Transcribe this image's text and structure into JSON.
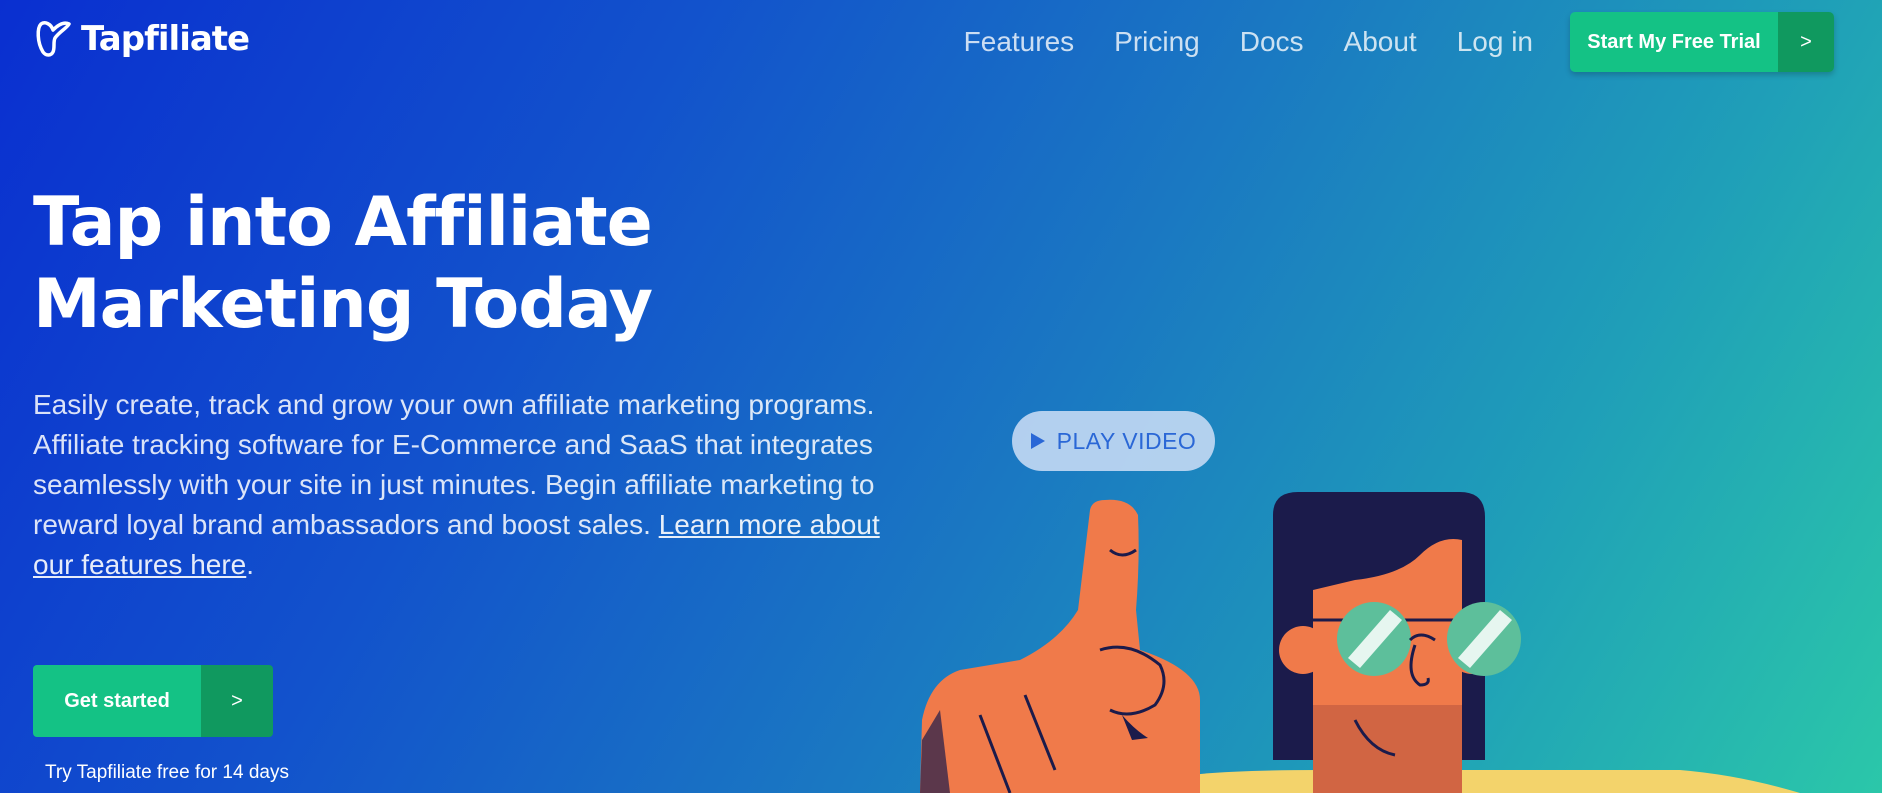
{
  "brand": {
    "name": "Tapfiliate"
  },
  "nav": {
    "items": [
      {
        "label": "Features"
      },
      {
        "label": "Pricing"
      },
      {
        "label": "Docs"
      },
      {
        "label": "About"
      },
      {
        "label": "Log in"
      }
    ],
    "cta_label": "Start My Free Trial",
    "cta_arrow": ">"
  },
  "hero": {
    "title_line1": "Tap into Affiliate",
    "title_line2": "Marketing Today",
    "description": "Easily create, track and grow your own affiliate marketing programs. Affiliate tracking software for E-Commerce and SaaS that integrates seamlessly with your site in just minutes. Begin affiliate marketing to reward loyal brand ambassadors and boost sales.",
    "link_text": "Learn more about our features here",
    "link_suffix": ".",
    "cta_label": "Get started",
    "cta_arrow": ">",
    "trial_note": "Try Tapfiliate free for 14 days"
  },
  "video": {
    "label": "PLAY VIDEO",
    "icon": "play-icon"
  },
  "colors": {
    "accent_green": "#14c285",
    "accent_green_dark": "#10995f",
    "gradient_start": "#0a2fd0",
    "gradient_end": "#2bc7a9",
    "illustration_orange": "#f07a4a",
    "illustration_navy": "#1b1b4b"
  }
}
